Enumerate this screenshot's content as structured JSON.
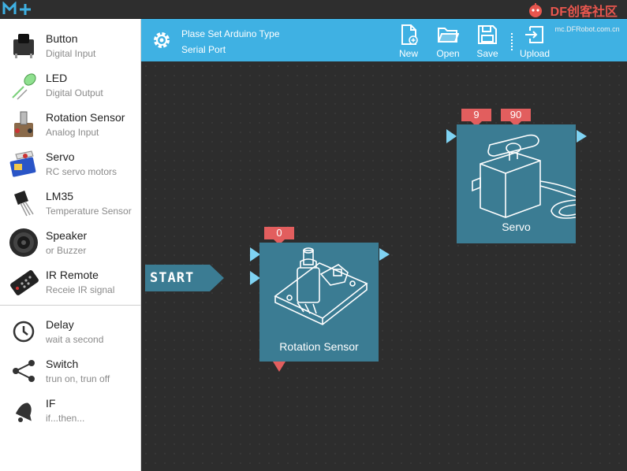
{
  "app": {
    "logo_text": "M+"
  },
  "brand": {
    "name": "DF创客社区",
    "url": "mc.DFRobot.com.cn"
  },
  "sidebar": {
    "components": [
      {
        "name": "Button",
        "desc": "Digital Input",
        "icon": "button-icon"
      },
      {
        "name": "LED",
        "desc": "Digital Output",
        "icon": "led-icon"
      },
      {
        "name": "Rotation Sensor",
        "desc": "Analog Input",
        "icon": "rotation-sensor-icon"
      },
      {
        "name": "Servo",
        "desc": "RC servo motors",
        "icon": "servo-icon"
      },
      {
        "name": "LM35",
        "desc": "Temperature Sensor",
        "icon": "lm35-icon"
      },
      {
        "name": "Speaker",
        "desc": "or Buzzer",
        "icon": "speaker-icon"
      },
      {
        "name": "IR Remote",
        "desc": "Receie IR signal",
        "icon": "ir-remote-icon"
      }
    ],
    "logic": [
      {
        "name": "Delay",
        "desc": "wait a second",
        "icon": "clock-icon"
      },
      {
        "name": "Switch",
        "desc": "trun on, trun off",
        "icon": "share-icon"
      },
      {
        "name": "IF",
        "desc": "if...then...",
        "icon": "bell-icon"
      }
    ]
  },
  "toolbar": {
    "board_type": "Plase Set Arduino Type",
    "serial_port": "Serial Port",
    "new_label": "New",
    "open_label": "Open",
    "save_label": "Save",
    "upload_label": "Upload"
  },
  "canvas": {
    "start_label": "START",
    "blocks": {
      "rotation": {
        "name": "Rotation Sensor",
        "param": "0"
      },
      "servo": {
        "name": "Servo",
        "params": [
          "9",
          "90"
        ]
      }
    }
  },
  "colors": {
    "toolbar": "#3fb1e3",
    "block": "#3b7c93",
    "param": "#e25e5e",
    "port": "#7fd3f3",
    "brand": "#e8564e"
  }
}
